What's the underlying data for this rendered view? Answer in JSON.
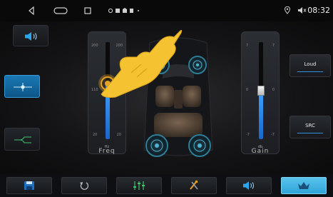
{
  "status_bar": {
    "time": "08:32"
  },
  "left_buttons": [
    {
      "name": "speaker-volume-button",
      "icon": "speaker-icon",
      "active": false
    },
    {
      "name": "balance-position-button",
      "icon": "crosshair-icon",
      "active": true
    },
    {
      "name": "crossover-button",
      "icon": "crossover-icon",
      "active": false
    }
  ],
  "freq_slider": {
    "label": "Freq",
    "unit": "Hz",
    "scale_top": "200",
    "scale_mid": "110",
    "scale_bottom": "20",
    "scale_top_right": "200",
    "scale_mid_right": "110",
    "scale_bottom_right": "20",
    "value_fraction": 0.57
  },
  "gain_slider": {
    "label": "Gain",
    "unit": "db",
    "scale_top": "7",
    "scale_mid": "0",
    "scale_bottom": "-7",
    "scale_top_right": "7",
    "scale_mid_right": "0",
    "scale_bottom_right": "-7",
    "value_fraction": 0.5
  },
  "right_buttons": {
    "loud_label": "Loud",
    "src_label": "SRC"
  },
  "bottom_tabs": [
    {
      "icon": "save-icon",
      "active": false
    },
    {
      "icon": "reset-icon",
      "active": false
    },
    {
      "icon": "equalizer-icon",
      "active": false
    },
    {
      "icon": "tools-icon",
      "active": false
    },
    {
      "icon": "speaker-icon",
      "active": false
    },
    {
      "icon": "crown-icon",
      "active": true
    }
  ],
  "colors": {
    "accent_blue": "#1a78b4",
    "active_tab": "#3fb0df",
    "slider_fill": "#2f8fe0"
  }
}
